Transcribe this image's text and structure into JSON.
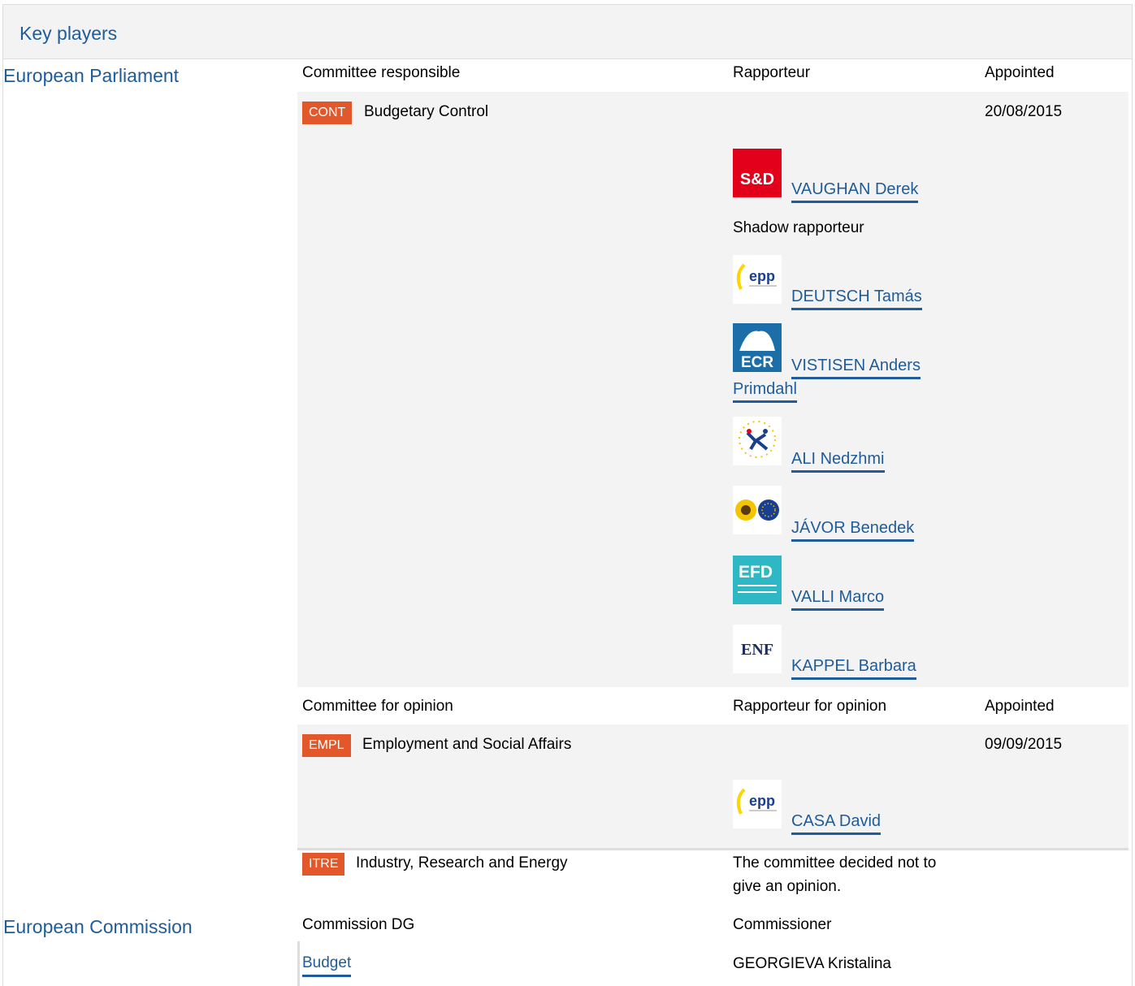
{
  "header": {
    "title": "Key players"
  },
  "parliament": {
    "label": "European Parliament",
    "col_committee": "Committee responsible",
    "col_rapporteur": "Rapporteur",
    "col_appointed": "Appointed",
    "responsible": {
      "tag": "CONT",
      "name": "Budgetary Control",
      "date": "20/08/2015"
    },
    "rapporteur": {
      "group": "S&D",
      "name": "VAUGHAN Derek"
    },
    "shadow_label": "Shadow rapporteur",
    "shadows": [
      {
        "group": "epp",
        "name": "DEUTSCH Tamás"
      },
      {
        "group": "ECR",
        "name_line1": "VISTISEN Anders",
        "name_line2": "Primdahl"
      },
      {
        "group": "ALDE",
        "name": "ALI Nedzhmi"
      },
      {
        "group": "Greens/EFA",
        "name": "JÁVOR Benedek"
      },
      {
        "group": "EFD",
        "name": "VALLI Marco"
      },
      {
        "group": "ENF",
        "name": "KAPPEL Barbara"
      }
    ],
    "opinion": {
      "col_committee": "Committee for opinion",
      "col_rapporteur": "Rapporteur for opinion",
      "col_appointed": "Appointed",
      "empl": {
        "tag": "EMPL",
        "name": "Employment and Social Affairs",
        "date": "09/09/2015",
        "rapporteur_group": "epp",
        "rapporteur": "CASA David"
      },
      "itre": {
        "tag": "ITRE",
        "name": "Industry, Research and Energy",
        "note_line1": "The committee decided not to",
        "note_line2": "give an opinion."
      }
    }
  },
  "commission": {
    "label": "European Commission",
    "col_dg": "Commission DG",
    "col_commissioner": "Commissioner",
    "dg": "Budget",
    "commissioner": "GEORGIEVA Kristalina"
  },
  "colors": {
    "link": "#1f5c99",
    "tag": "#e2582a",
    "panel": "#f3f3f3"
  }
}
